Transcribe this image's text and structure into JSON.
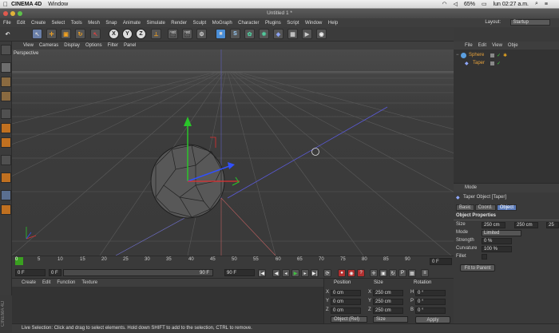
{
  "mac": {
    "app": "CINEMA 4D",
    "menu": [
      "Window"
    ],
    "battery": "65%",
    "clock": "lun 02:27 a.m."
  },
  "window": {
    "title": "Untitled 1 *"
  },
  "menu": [
    "File",
    "Edit",
    "Create",
    "Select",
    "Tools",
    "Mesh",
    "Snap",
    "Animate",
    "Simulate",
    "Render",
    "Sculpt",
    "MoGraph",
    "Character",
    "Plugins",
    "Script",
    "Window",
    "Help"
  ],
  "layout": {
    "label": "Layout:",
    "value": "Startup"
  },
  "toolbar": {
    "axes": [
      "X",
      "Y",
      "Z"
    ]
  },
  "viewport": {
    "menu": [
      "View",
      "Cameras",
      "Display",
      "Options",
      "Filter",
      "Panel"
    ],
    "label": "Perspective"
  },
  "timeline": {
    "ticks": [
      "0",
      "5",
      "10",
      "15",
      "20",
      "25",
      "30",
      "35",
      "40",
      "45",
      "50",
      "55",
      "60",
      "65",
      "70",
      "75",
      "80",
      "85",
      "90"
    ],
    "end_field": "0 F",
    "current_frame": "0 F",
    "start_field": "0 F",
    "range_end": "90 F",
    "max_field": "90 F"
  },
  "materials": {
    "menu": [
      "Create",
      "Edit",
      "Function",
      "Texture"
    ]
  },
  "coords": {
    "headers": {
      "position": "Position",
      "size": "Size",
      "rotation": "Rotation"
    },
    "rows": [
      {
        "axis": "X",
        "pos": "0 cm",
        "size_axis": "X",
        "size": "250 cm",
        "rot_axis": "H",
        "rot": "0 °"
      },
      {
        "axis": "Y",
        "pos": "0 cm",
        "size_axis": "Y",
        "size": "250 cm",
        "rot_axis": "P",
        "rot": "0 °"
      },
      {
        "axis": "Z",
        "pos": "0 cm",
        "size_axis": "Z",
        "size": "250 cm",
        "rot_axis": "B",
        "rot": "0 °"
      }
    ],
    "mode": "Object (Rel)",
    "size_mode": "Size",
    "apply": "Apply"
  },
  "objects": {
    "menu": [
      "File",
      "Edit",
      "View",
      "Obje"
    ],
    "items": [
      {
        "name": "Sphere"
      },
      {
        "name": "Taper"
      }
    ]
  },
  "attributes": {
    "menu": "Mode",
    "object_title": "Taper Object [Taper]",
    "tabs": [
      "Basic",
      "Coord.",
      "Object"
    ],
    "section": "Object Properties",
    "size_label": "Size",
    "size_values": [
      "250 cm",
      "250 cm",
      "25"
    ],
    "mode_label": "Mode",
    "mode_value": "Limited",
    "strength_label": "Strength",
    "strength_value": "0 %",
    "curvature_label": "Curvature",
    "curvature_value": "100 %",
    "fillet_label": "Fillet",
    "fit_button": "Fit to Parent"
  },
  "status": "Live Selection: Click and drag to select elements. Hold down SHIFT to add to the selection, CTRL to remove.",
  "side_label": "CINEMA 4D"
}
